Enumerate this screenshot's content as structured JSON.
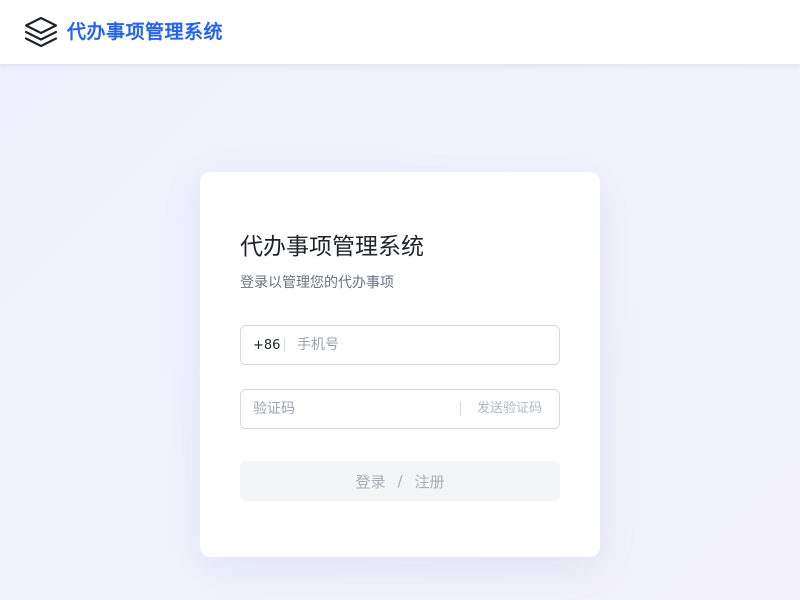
{
  "header": {
    "logo_icon": "layers-icon",
    "title": "代办事项管理系统",
    "title_color": "#2563eb"
  },
  "login": {
    "title": "代办事项管理系统",
    "subtitle": "登录以管理您的代办事项",
    "phone": {
      "prefix": "+86",
      "placeholder": "手机号",
      "value": ""
    },
    "code": {
      "placeholder": "验证码",
      "value": "",
      "send_label": "发送验证码"
    },
    "submit": {
      "login_label": "登录",
      "divider": "/",
      "register_label": "注册"
    }
  }
}
